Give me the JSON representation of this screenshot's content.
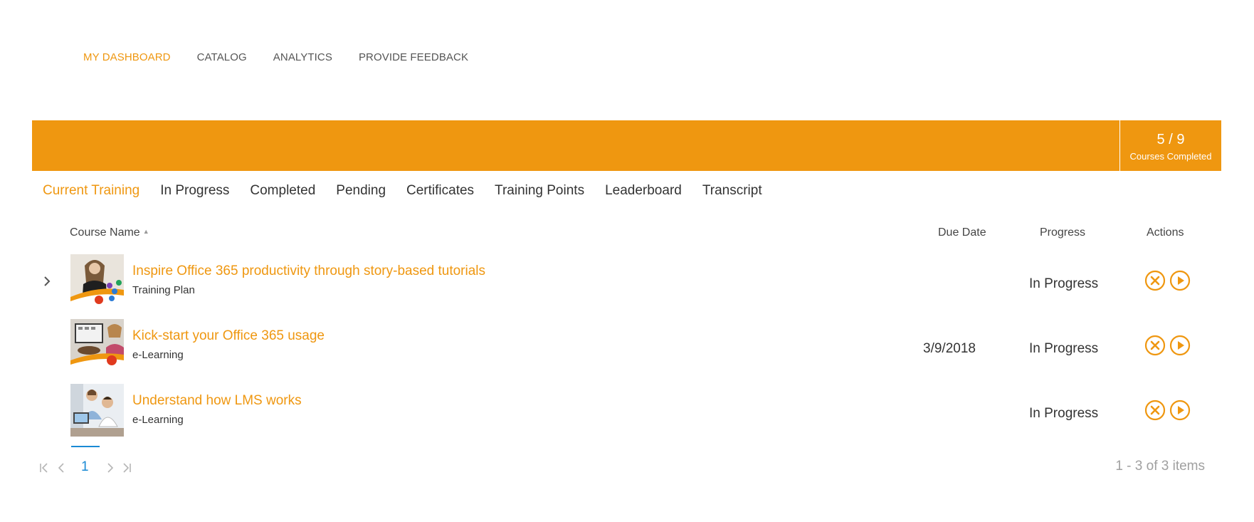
{
  "nav": {
    "items": [
      "MY DASHBOARD",
      "CATALOG",
      "ANALYTICS",
      "PROVIDE FEEDBACK"
    ],
    "active_index": 0
  },
  "banner": {
    "stat_value": "5 / 9",
    "stat_label": "Courses Completed",
    "color": "#ef9710"
  },
  "tabs": {
    "items": [
      "Current Training",
      "In Progress",
      "Completed",
      "Pending",
      "Certificates",
      "Training Points",
      "Leaderboard",
      "Transcript"
    ],
    "active_index": 0
  },
  "table": {
    "columns": {
      "course_name": "Course Name",
      "due_date": "Due Date",
      "progress": "Progress",
      "actions": "Actions"
    },
    "rows": [
      {
        "title": "Inspire Office 365 productivity through story-based tutorials",
        "type": "Training Plan",
        "due_date": "",
        "progress": "In Progress",
        "expandable": true
      },
      {
        "title": "Kick-start your Office 365 usage",
        "type": "e-Learning",
        "due_date": "3/9/2018",
        "progress": "In Progress",
        "expandable": false
      },
      {
        "title": "Understand how LMS works",
        "type": "e-Learning",
        "due_date": "",
        "progress": "In Progress",
        "expandable": false
      }
    ]
  },
  "pager": {
    "current_page": "1",
    "info": "1 - 3 of 3 items"
  },
  "colors": {
    "accent": "#ef9710",
    "link_blue": "#1a8ad4",
    "muted": "#a0a0a0"
  },
  "icons": [
    "expand-chevron-icon",
    "cancel-circle-icon",
    "play-circle-icon",
    "first-page-icon",
    "prev-page-icon",
    "next-page-icon",
    "last-page-icon"
  ]
}
